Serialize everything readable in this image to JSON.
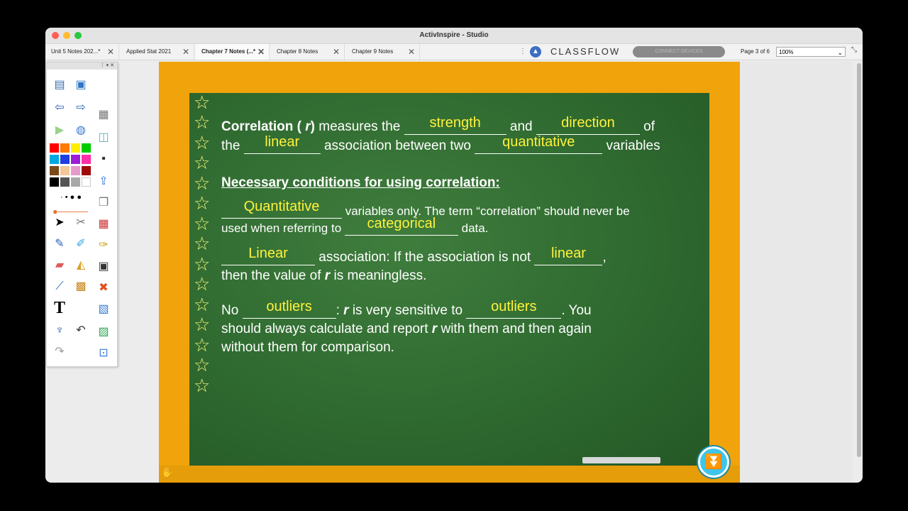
{
  "window": {
    "title": "ActivInspire - Studio"
  },
  "tabs": [
    {
      "label": "Unit 5 Notes 202...*"
    },
    {
      "label": "Applied Stat 2021"
    },
    {
      "label": "Chapter 7 Notes (...*",
      "active": true
    },
    {
      "label": "Chapter 8 Notes"
    },
    {
      "label": "Chapter 9 Notes"
    }
  ],
  "tab_close_glyph": "✕",
  "classflow": {
    "brand": "CLASSFLOW",
    "connect_label": "CONNECT DEVICES"
  },
  "page_indicator": "Page 3 of 6",
  "zoom": {
    "value": "100%"
  },
  "colors": {
    "palette": [
      "#ff0000",
      "#ff7a00",
      "#ffee00",
      "#00cc00",
      "#00a8e0",
      "#1f3fe0",
      "#9b1fd6",
      "#ff2fa8",
      "#7a4a1a",
      "#f2c79a",
      "#e59acb",
      "#9e0b0b",
      "#000000",
      "#555555",
      "#a8a8a8",
      "#ffffff"
    ],
    "chalkboard": "#2f6a30",
    "page_border": "#f0a30a",
    "fill_text": "#fff23a"
  },
  "board": {
    "p1": {
      "l1_a": "Correlation ( ",
      "l1_r": "r",
      "l1_b": ")",
      "l1_c": " measures the ",
      "fill_strength": "strength",
      "l1_d": " and ",
      "fill_direction": "direction",
      "l1_e": " of",
      "l2_a": "the ",
      "fill_linear": "linear",
      "l2_b": " association between two ",
      "fill_quantitative": "quantitative",
      "l2_c": " variables"
    },
    "heading": "Necessary conditions for using correlation:",
    "p2": {
      "fill_quantitative": "Quantitative",
      "l1_b": " variables only.  The term “correlation” should never be",
      "l2_a": "used when referring to ",
      "fill_categorical": "categorical",
      "l2_b": " data."
    },
    "p3": {
      "fill_linear_cap": "Linear",
      "l1_b": " association:  If the association is not ",
      "fill_linear": "linear",
      "l1_c": ",",
      "l2_a": "then the value of ",
      "l2_r": "r",
      "l2_b": " is meaningless."
    },
    "p4": {
      "l1_a": "No ",
      "fill_outliers1": "outliers",
      "l1_b": ":  ",
      "l1_r": "r",
      "l1_c": " is very sensitive to ",
      "fill_outliers2": "outliers",
      "l1_d": ".  You",
      "l2_a": "should always calculate and report  ",
      "l2_r": "r",
      "l2_b": " with them and then again",
      "l3": "without them for comparison."
    }
  }
}
